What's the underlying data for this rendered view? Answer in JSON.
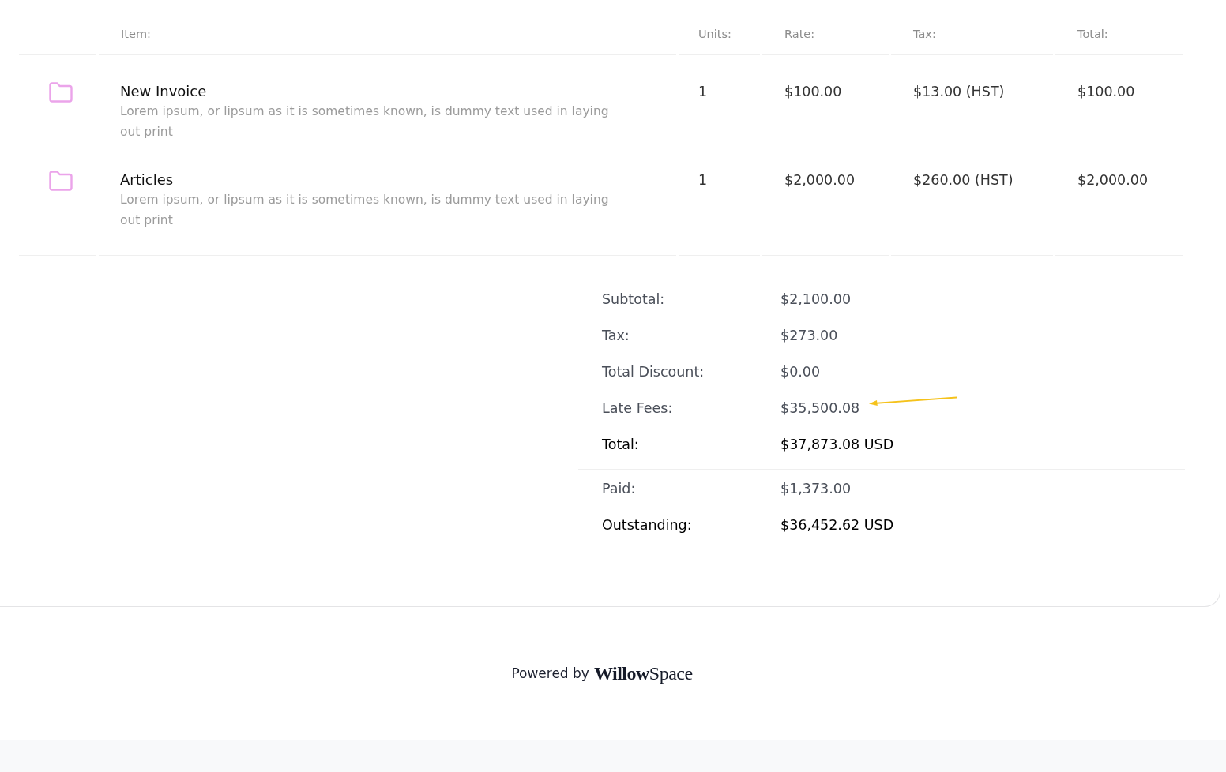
{
  "table": {
    "columns": [
      "Item:",
      "Units:",
      "Rate:",
      "Tax:",
      "Total:"
    ],
    "rows": [
      {
        "title": "New Invoice",
        "description": "Lorem ipsum, or lipsum as it is sometimes known, is dummy text used in laying out print",
        "units": "1",
        "rate": "$100.00",
        "tax": "$13.00 (HST)",
        "total": "$100.00"
      },
      {
        "title": "Articles",
        "description": "Lorem ipsum, or lipsum as it is sometimes known, is dummy text used in laying out print",
        "units": "1",
        "rate": "$2,000.00",
        "tax": "$260.00 (HST)",
        "total": "$2,000.00"
      }
    ]
  },
  "totals": [
    {
      "label": "Subtotal:",
      "value": "$2,100.00",
      "kind": "plain",
      "marked": false
    },
    {
      "label": "Tax:",
      "value": "$273.00",
      "kind": "plain",
      "marked": false
    },
    {
      "label": "Total Discount:",
      "value": "$0.00",
      "kind": "plain",
      "marked": false
    },
    {
      "label": "Late Fees:",
      "value": "$35,500.08",
      "kind": "plain",
      "marked": true
    },
    {
      "label": "Total:",
      "value": "$37,873.08 USD",
      "kind": "strong",
      "marked": false
    }
  ],
  "balance": [
    {
      "label": "Paid:",
      "value": "$1,373.00",
      "kind": "plain",
      "marked": false
    },
    {
      "label": "Outstanding:",
      "value": "$36,452.62 USD",
      "kind": "strong",
      "marked": false
    }
  ],
  "footer": {
    "powered_by": "Powered by",
    "brand": "**Willow**Space"
  }
}
